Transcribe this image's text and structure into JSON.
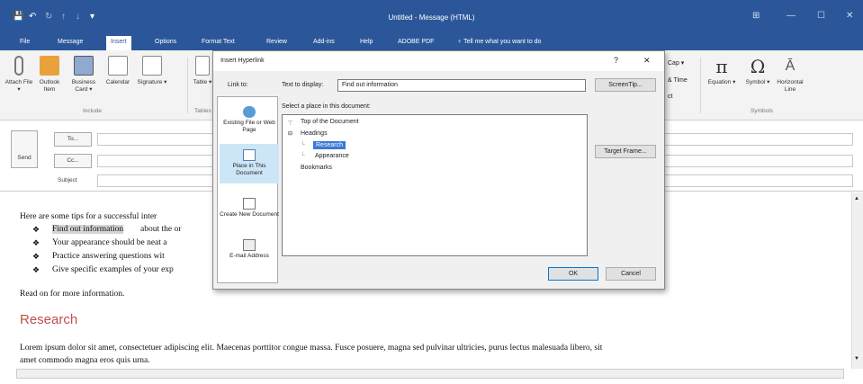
{
  "window": {
    "title": "Untitled  -  Message (HTML)",
    "qat": [
      "💾",
      "↶",
      "↻",
      "↑",
      "↓",
      "▾"
    ],
    "controls": [
      "⊞",
      "—",
      "☐",
      "✕"
    ]
  },
  "tabs": [
    "File",
    "Message",
    "Insert",
    "Options",
    "Format Text",
    "Review",
    "Add-ins",
    "Help",
    "ADOBE PDF",
    "♀ Tell me what you want to do"
  ],
  "ribbon": {
    "buttons": [
      "Attach File ▾",
      "Outlook Item",
      "Business Card ▾",
      "Calendar",
      "Signature ▾",
      "Table ▾"
    ],
    "right_small": [
      "Cap ▾",
      "& Time",
      "ct"
    ],
    "right_buttons": [
      "Equation ▾",
      "Symbol ▾",
      "Horizontal Line"
    ],
    "groups": {
      "include": "Include",
      "tables": "Tables",
      "symbols": "Symbols"
    }
  },
  "compose": {
    "send": "Send",
    "to": "To...",
    "cc": "Cc...",
    "subject": "Subject"
  },
  "body": {
    "intro": "Here are some tips for a successful inter",
    "bullets": [
      "Find out information about the or",
      "Your appearance should be neat a",
      "Practice answering questions wit",
      "Give specific examples of your exp"
    ],
    "highlight": "Find out information",
    "readon": "Read on for more information.",
    "heading": "Research",
    "lorem1": "Lorem ipsum dolor sit amet, consectetuer adipiscing elit. Maecenas porttitor congue massa. Fusce posuere, magna sed pulvinar ultricies, purus lectus malesuada libero, sit",
    "lorem2": "amet commodo magna eros quis urna."
  },
  "dialog": {
    "title": "Insert Hyperlink",
    "help": "?",
    "close": "✕",
    "link_to": "Link to:",
    "text_to_display_label": "Text to display:",
    "text_to_display_value": "Find out information",
    "screentip": "ScreenTip...",
    "select_place": "Select a place in this document:",
    "target_frame": "Target Frame...",
    "ok": "OK",
    "cancel": "Cancel",
    "link_types": [
      {
        "label": "Existing File or Web Page",
        "icon": "globe-file-icon"
      },
      {
        "label": "Place in This Document",
        "icon": "document-place-icon"
      },
      {
        "label": "Create New Document",
        "icon": "new-document-icon"
      },
      {
        "label": "E-mail Address",
        "icon": "email-icon"
      }
    ],
    "tree": {
      "top": "Top of the Document",
      "headings": "Headings",
      "research": "Research",
      "appearance": "Appearance",
      "bookmarks": "Bookmarks"
    }
  },
  "colors": {
    "brand": "#2b579a",
    "selection": "#3a78d6",
    "heading": "#c0504d"
  }
}
